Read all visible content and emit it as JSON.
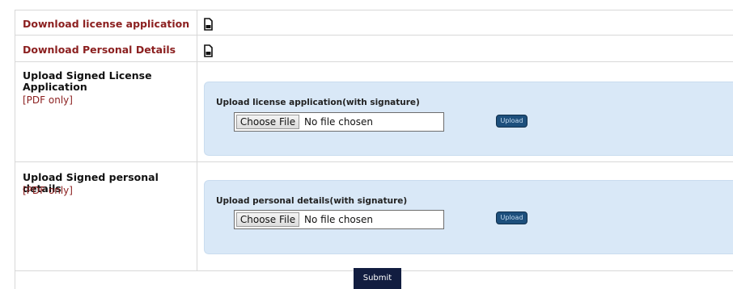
{
  "rows": {
    "download_license": {
      "label": "Download license application",
      "icon": "document-download-icon"
    },
    "download_personal": {
      "label": "Download Personal Details",
      "icon": "document-download-icon"
    },
    "upload_license": {
      "label_line1": "Upload Signed License",
      "label_line2": "Application",
      "note": "[PDF only]",
      "panel_title": "Upload license application(with signature)",
      "choose_label": "Choose File",
      "file_status": "No file chosen",
      "upload_label": "Upload"
    },
    "upload_personal": {
      "label": "Upload Signed personal details",
      "note": "[PDF only]",
      "panel_title": "Upload personal details(with signature)",
      "choose_label": "Choose File",
      "file_status": "No file chosen",
      "upload_label": "Upload"
    }
  },
  "submit_label": "Submit",
  "colors": {
    "link": "#8b1f1f",
    "panel": "#d9e8f7",
    "upload_button": "#1d4f7c",
    "submit_button": "#121d40"
  }
}
